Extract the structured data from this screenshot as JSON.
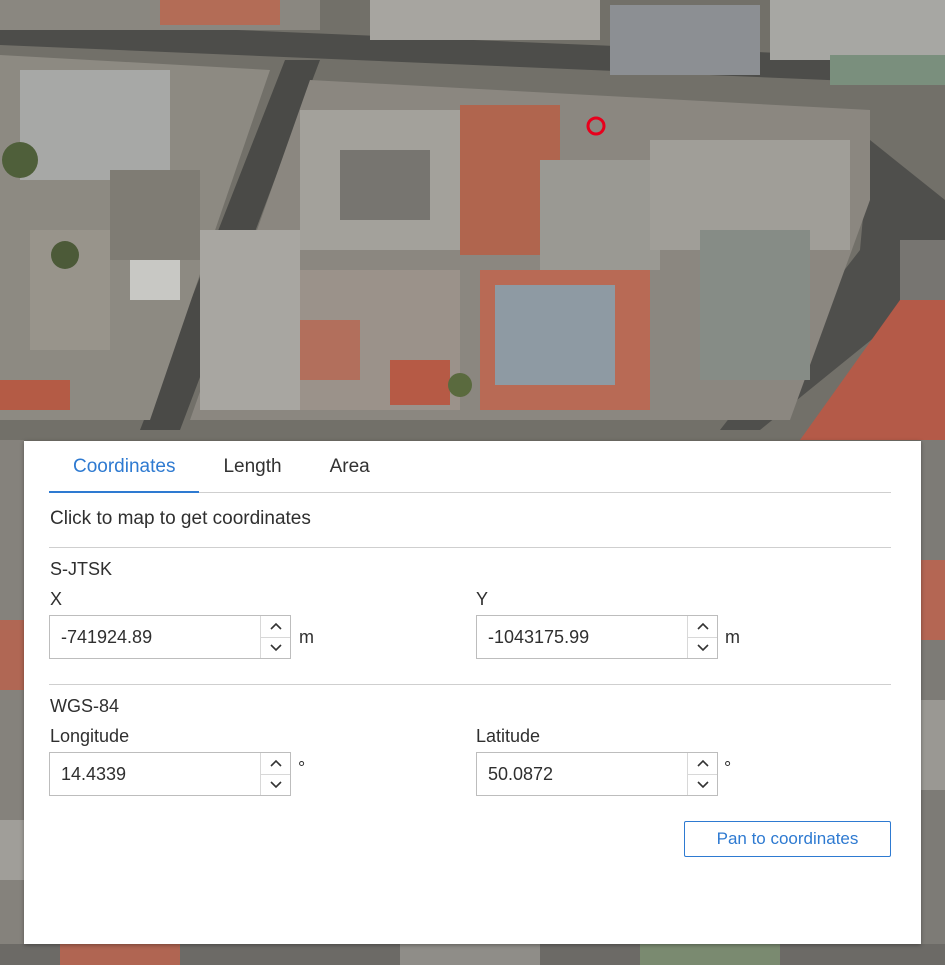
{
  "tabs": [
    {
      "label": "Coordinates",
      "active": true
    },
    {
      "label": "Length",
      "active": false
    },
    {
      "label": "Area",
      "active": false
    }
  ],
  "hint": "Click to map to get coordinates",
  "sjtsk": {
    "title": "S-JTSK",
    "x": {
      "label": "X",
      "value": "-741924.89",
      "unit": "m"
    },
    "y": {
      "label": "Y",
      "value": "-1043175.99",
      "unit": "m"
    }
  },
  "wgs84": {
    "title": "WGS-84",
    "longitude": {
      "label": "Longitude",
      "value": "14.4339",
      "unit": "°"
    },
    "latitude": {
      "label": "Latitude",
      "value": "50.0872",
      "unit": "°"
    }
  },
  "pan_button": "Pan to coordinates",
  "colors": {
    "accent": "#2e7ad1",
    "marker": "#e8001c"
  }
}
